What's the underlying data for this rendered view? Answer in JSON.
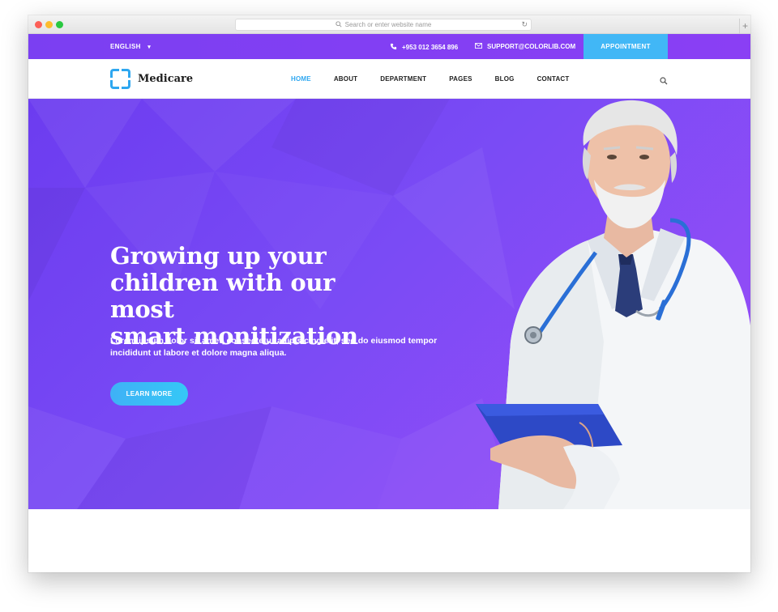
{
  "browser": {
    "address_placeholder": "Search or enter website name",
    "new_tab": "+"
  },
  "topbar": {
    "language": "ENGLISH",
    "phone": "+953 012 3654 896",
    "email": "SUPPORT@COLORLIB.COM",
    "appointment": "APPOINTMENT"
  },
  "brand": {
    "name": "Medicare"
  },
  "nav": {
    "items": [
      {
        "label": "HOME",
        "active": true
      },
      {
        "label": "ABOUT"
      },
      {
        "label": "DEPARTMENT"
      },
      {
        "label": "PAGES"
      },
      {
        "label": "BLOG"
      },
      {
        "label": "CONTACT"
      }
    ]
  },
  "hero": {
    "title_line1": "Growing up your",
    "title_line2": "children with our most",
    "title_line3": "smart monitization",
    "text": "Lorem ipsum dolor sit amet, consectetur adipisicing elit, sed do eiusmod tempor incididunt ut labore et dolore magna aliqua.",
    "button": "LEARN MORE"
  },
  "colors": {
    "primary_purple": "#7b3ff2",
    "accent_blue": "#2ea7f0",
    "appointment_blue": "#41b7f6"
  },
  "icons": [
    "search-icon",
    "reload-icon",
    "phone-icon",
    "mail-icon",
    "chevron-down-icon",
    "logo-icon"
  ]
}
